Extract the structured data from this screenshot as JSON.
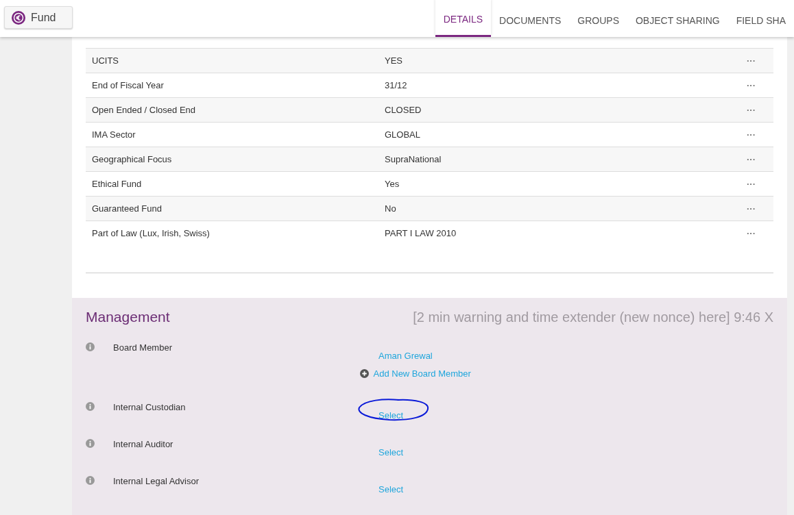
{
  "header": {
    "button": "Fund",
    "tabs": [
      {
        "label": "DETAILS",
        "selected": true
      },
      {
        "label": "DOCUMENTS",
        "selected": false
      },
      {
        "label": "GROUPS",
        "selected": false
      },
      {
        "label": "OBJECT SHARING",
        "selected": false
      },
      {
        "label": "FIELD SHA",
        "selected": false
      }
    ]
  },
  "details": {
    "rows": [
      {
        "label": "UCITS",
        "value": "YES",
        "menu": "···"
      },
      {
        "label": "End of Fiscal Year",
        "value": "31/12",
        "menu": "···"
      },
      {
        "label": "Open Ended / Closed End",
        "value": "CLOSED",
        "menu": "···"
      },
      {
        "label": "IMA Sector",
        "value": "GLOBAL",
        "menu": "···"
      },
      {
        "label": "Geographical Focus",
        "value": "SupraNational",
        "menu": "···"
      },
      {
        "label": "Ethical Fund",
        "value": "Yes",
        "menu": "···"
      },
      {
        "label": "Guaranteed Fund",
        "value": "No",
        "menu": "···"
      },
      {
        "label": "Part of Law (Lux, Irish, Swiss)",
        "value": "PART I LAW 2010",
        "menu": "···"
      }
    ]
  },
  "management": {
    "title": "Management",
    "notice": "[2 min warning and time extender (new nonce) here] 9:46 X",
    "fields": [
      {
        "label": "Board Member",
        "links": [
          "Aman Grewal"
        ],
        "add": "Add New Board Member",
        "circled": false
      },
      {
        "label": "Internal Custodian",
        "links": [
          "Select"
        ],
        "circled": true
      },
      {
        "label": "Internal Auditor",
        "links": [
          "Select"
        ],
        "circled": false
      },
      {
        "label": "Internal Legal Advisor",
        "links": [
          "Select"
        ],
        "circled": false
      }
    ]
  }
}
